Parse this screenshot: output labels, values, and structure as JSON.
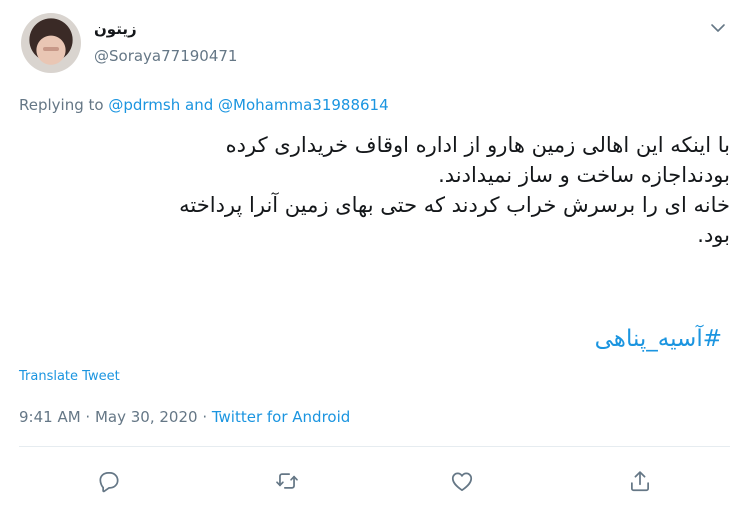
{
  "author": {
    "display_name": "زیتون",
    "handle": "@Soraya77190471"
  },
  "reply": {
    "prefix": "Replying to",
    "mention_1": "@pdrmsh",
    "conjunction": "and",
    "mention_2": "@Mohamma31988614"
  },
  "tweet": {
    "lines": [
      "با اینکه این اهالی زمین هارو از اداره  اوقاف خریداری کرده",
      "بودنداجازه ساخت و ساز  نمیدادند.",
      "خانه ای را برسرش خراب کردند که حتی بهای زمین آنرا پرداخته",
      "بود."
    ],
    "hashtag": "#آسیه_پناهی"
  },
  "translate_label": "Translate Tweet",
  "meta": {
    "time": "9:41 AM",
    "sep1": " · ",
    "date": "May 30, 2020",
    "sep2": " · ",
    "source": "Twitter for Android"
  },
  "icons": {
    "more": "chevron-down-icon",
    "reply": "reply-icon",
    "retweet": "retweet-icon",
    "like": "like-icon",
    "share": "share-icon"
  },
  "colors": {
    "link": "#1b95e0",
    "secondary_text": "#657786",
    "primary_text": "#14171a",
    "icon": "#657786"
  }
}
